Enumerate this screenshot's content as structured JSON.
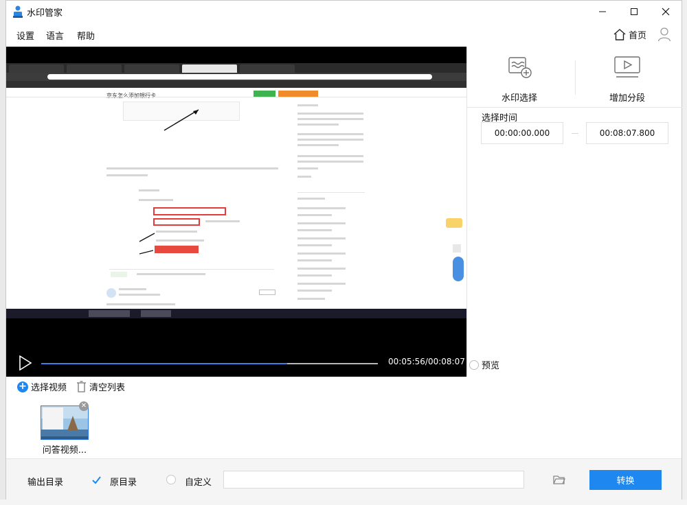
{
  "app": {
    "title": "水印管家"
  },
  "window_controls": {
    "minimize": "—",
    "maximize": "☐",
    "close": "✕"
  },
  "menu": {
    "items": [
      "设置",
      "语言",
      "帮助"
    ],
    "home_label": "首页"
  },
  "player": {
    "time_readout": "00:05:56/00:08:07",
    "progress_fraction": 0.73
  },
  "right_panel": {
    "tabs": [
      {
        "label": "水印选择",
        "icon": "watermark-add-icon"
      },
      {
        "label": "增加分段",
        "icon": "video-segment-icon"
      }
    ],
    "select_time_label": "选择时间",
    "start_time": "00:00:00.000",
    "end_time": "00:08:07.800",
    "preview_label": "预览"
  },
  "file_list": {
    "add_label": "选择视频",
    "clear_label": "清空列表",
    "items": [
      {
        "name": "问答视频..."
      }
    ]
  },
  "output": {
    "label": "输出目录",
    "original_dir_label": "原目录",
    "custom_dir_label": "自定义",
    "path_value": "",
    "convert_label": "转换",
    "selected": "original"
  },
  "colors": {
    "accent": "#1e88f0",
    "progress": "#3e80ea"
  },
  "video_frame": {
    "page_title": "京东怎么添加银行卡"
  }
}
